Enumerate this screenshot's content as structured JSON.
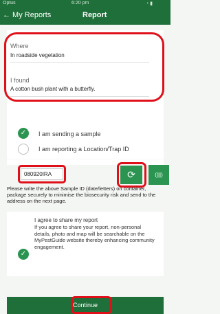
{
  "status_bar": {
    "carrier": "Optus",
    "time": "6:20 pm"
  },
  "nav": {
    "back_label": "← My Reports",
    "title": "Report"
  },
  "form": {
    "where": {
      "label": "Where",
      "value": "In roadside vegetation"
    },
    "found": {
      "label": "I found",
      "value": "A cotton bush plant with a butterfly."
    }
  },
  "options": {
    "location": {
      "label": "I am reporting a Location/Trap ID",
      "checked": false
    },
    "sample": {
      "label": "I am sending a sample",
      "checked": true
    }
  },
  "sample_id": {
    "value": "080920IRA"
  },
  "buttons": {
    "refresh_icon": "refresh-icon",
    "barcode_label": "(|||)",
    "continue_label": "Continue"
  },
  "instruction": "Please write the above Sample ID (date/letters) on container, package securely to minimise the biosecurity risk and send to the address on the next page.",
  "agree": {
    "title": "I agree to share my report",
    "body": "If you agree to share your report, non-personal details, photo and map will be searchable on the MyPestGuide website thereby enhancing community engagement.",
    "checked": true
  },
  "colors": {
    "header": "#1f6f3a",
    "accent": "#2a9450",
    "highlight": "#e0101a"
  }
}
